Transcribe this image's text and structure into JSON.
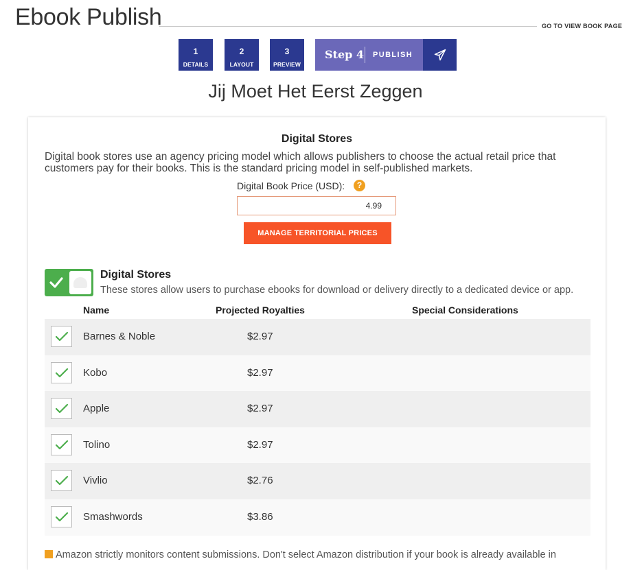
{
  "header": {
    "title": "Ebook Publish",
    "view_link": "GO TO VIEW BOOK PAGE"
  },
  "steps": [
    {
      "num": "1",
      "label": "DETAILS"
    },
    {
      "num": "2",
      "label": "LAYOUT"
    },
    {
      "num": "3",
      "label": "PREVIEW"
    }
  ],
  "current_step": {
    "title": "Step 4",
    "label": "PUBLISH",
    "icon": "paper-plane-icon"
  },
  "book_title": "Jij Moet Het Eerst Zeggen",
  "pricing": {
    "heading": "Digital Stores",
    "description": "Digital book stores use an agency pricing model which allows publishers to choose the actual retail price that customers pay for their books. This is the standard pricing model in self-published markets.",
    "price_label": "Digital Book Price (USD):",
    "help_icon_text": "?",
    "price_value": "4.99",
    "manage_button": "MANAGE TERRITORIAL PRICES"
  },
  "stores": {
    "title": "Digital Stores",
    "description": "These stores allow users to purchase ebooks for download or delivery directly to a dedicated device or app.",
    "toggle_on": true,
    "columns": {
      "name": "Name",
      "royalties": "Projected Royalties",
      "special": "Special Considerations"
    },
    "rows": [
      {
        "name": "Barnes & Noble",
        "royalty": "$2.97",
        "checked": true
      },
      {
        "name": "Kobo",
        "royalty": "$2.97",
        "checked": true
      },
      {
        "name": "Apple",
        "royalty": "$2.97",
        "checked": true
      },
      {
        "name": "Tolino",
        "royalty": "$2.97",
        "checked": true
      },
      {
        "name": "Vivlio",
        "royalty": "$2.76",
        "checked": true
      },
      {
        "name": "Smashwords",
        "royalty": "$3.86",
        "checked": true
      }
    ]
  },
  "note": "Amazon strictly monitors content submissions. Don't select Amazon distribution if your book is already available in",
  "colors": {
    "step_dark": "#2b3990",
    "step_active": "#6b68b9",
    "accent_orange": "#f75428",
    "toggle_green": "#4cae4c",
    "check_green": "#4cae4c"
  }
}
